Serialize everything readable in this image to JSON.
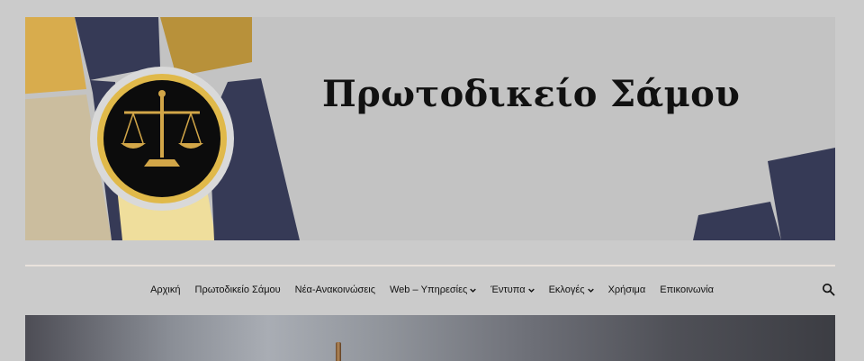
{
  "header": {
    "site_title": "Πρωτοδικείο Σάμου",
    "logo_icon": "scales-of-justice-icon"
  },
  "colors": {
    "background": "#cbcbcb",
    "banner_bg": "#c3c3c3",
    "navy": "#363a56",
    "gold": "#b8913a",
    "beige": "#cbbd9e",
    "pale_yellow": "#efde9c"
  },
  "nav": {
    "items": [
      {
        "label": "Αρχική",
        "has_dropdown": false
      },
      {
        "label": "Πρωτοδικείο Σάμου",
        "has_dropdown": false
      },
      {
        "label": "Νέα-Ανακοινώσεις",
        "has_dropdown": false
      },
      {
        "label": "Web – Υπηρεσίες",
        "has_dropdown": true
      },
      {
        "label": "Έντυπα",
        "has_dropdown": true
      },
      {
        "label": "Εκλογές",
        "has_dropdown": true
      },
      {
        "label": "Χρήσιμα",
        "has_dropdown": false
      },
      {
        "label": "Επικοινωνία",
        "has_dropdown": false
      }
    ],
    "search_icon": "search-icon"
  }
}
